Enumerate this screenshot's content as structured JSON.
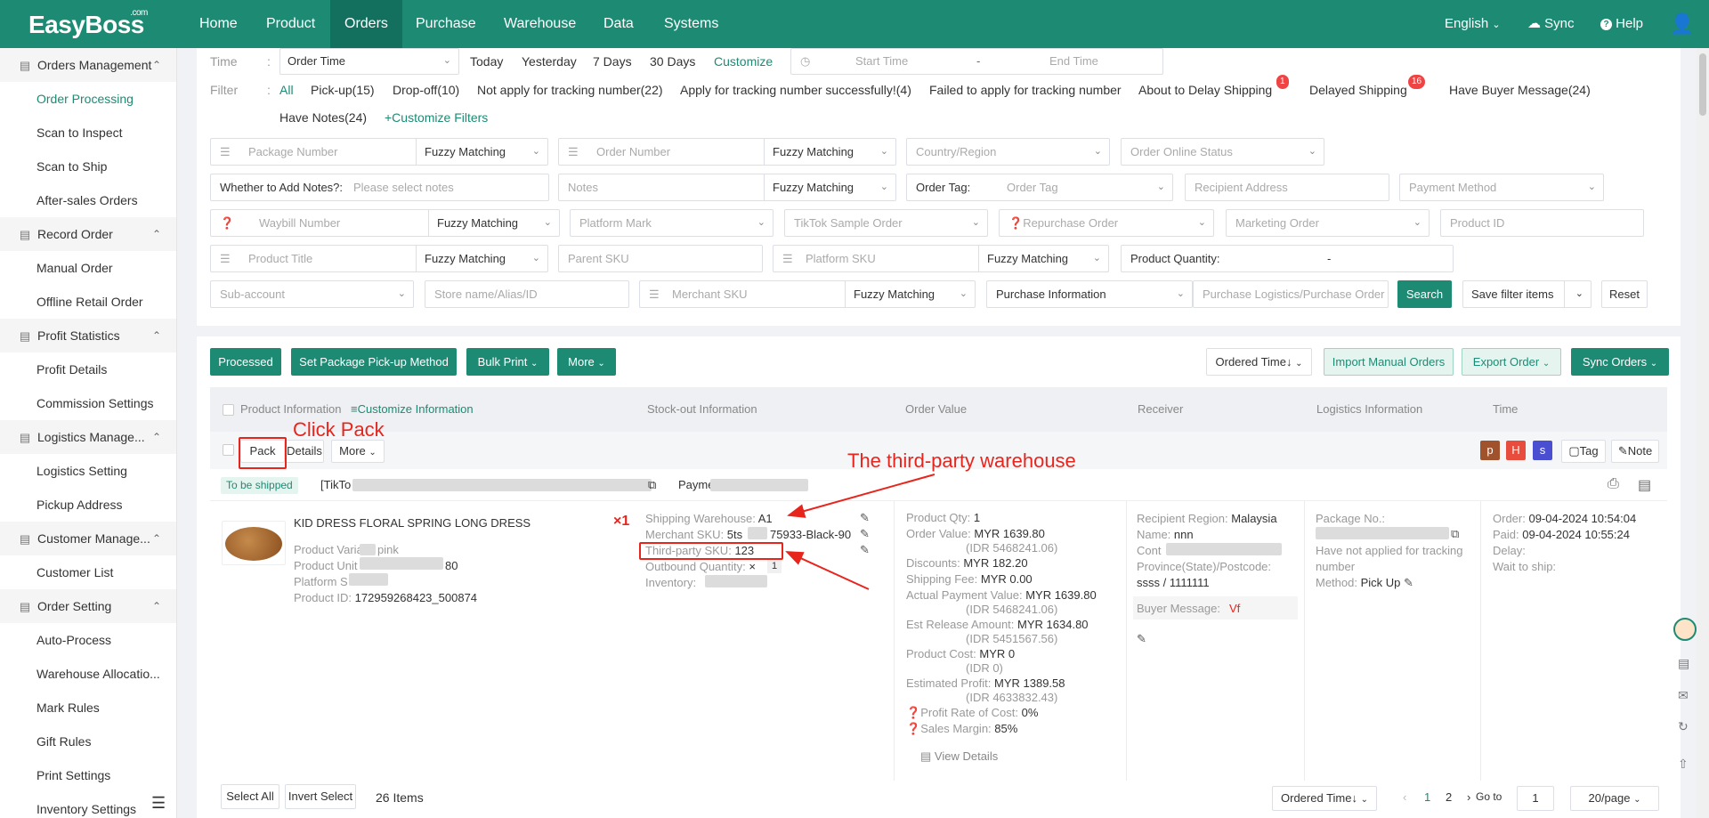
{
  "brand": {
    "logo": "EasyBoss",
    "logo_sup": ".com"
  },
  "topnav": {
    "items": [
      "Home",
      "Product",
      "Orders",
      "Purchase",
      "Warehouse",
      "Data",
      "Systems"
    ],
    "language": "English",
    "sync": "Sync",
    "help": "Help"
  },
  "sidebar": {
    "groups": [
      {
        "label": "Orders Management",
        "items": [
          "Order Processing",
          "Scan to Inspect",
          "Scan to Ship",
          "After-sales Orders"
        ]
      },
      {
        "label": "Record Order",
        "items": [
          "Manual Order",
          "Offline Retail Order"
        ]
      },
      {
        "label": "Profit Statistics",
        "items": [
          "Profit Details",
          "Commission Settings"
        ]
      },
      {
        "label": "Logistics Manage...",
        "items": [
          "Logistics Setting",
          "Pickup Address"
        ]
      },
      {
        "label": "Customer Manage...",
        "items": [
          "Customer List"
        ]
      },
      {
        "label": "Order Setting",
        "items": [
          "Auto-Process",
          "Warehouse Allocatio...",
          "Mark Rules",
          "Gift Rules",
          "Print Settings",
          "Inventory Settings"
        ]
      }
    ]
  },
  "filters": {
    "time_label": "Time",
    "time_select": "Order Time",
    "time_quick": [
      "Today",
      "Yesterday",
      "7 Days",
      "30 Days",
      "Customize"
    ],
    "start_time": "Start Time",
    "range_sep": "-",
    "end_time": "End Time",
    "filter_label": "Filter",
    "filter_items": [
      "All",
      "Pick-up(15)",
      "Drop-off(10)",
      "Not apply for tracking number(22)",
      "Apply for tracking number successfully!(4)",
      "Failed to apply for tracking number",
      "About to Delay Shipping",
      "Delayed Shipping",
      "Have Buyer Message(24)"
    ],
    "about_delay_badge": "1",
    "delayed_badge": "16",
    "have_notes": "Have Notes(24)",
    "customize_filters": "+Customize Filters",
    "row1": {
      "package_number": "Package Number",
      "fuzzy": "Fuzzy Matching",
      "order_number": "Order Number",
      "country": "Country/Region",
      "online_status": "Order Online Status"
    },
    "row2": {
      "notes_label": "Whether to Add Notes?:",
      "notes_ph": "Please select notes",
      "notes": "Notes",
      "fuzzy": "Fuzzy Matching",
      "order_tag_label": "Order Tag:",
      "order_tag_ph": "Order Tag",
      "recipient": "Recipient Address",
      "payment": "Payment Method"
    },
    "row3": {
      "waybill": "Waybill Number",
      "fuzzy": "Fuzzy Matching",
      "platform_mark": "Platform Mark",
      "tiktok_sample": "TikTok Sample Order",
      "repurchase": "Repurchase Order",
      "marketing": "Marketing Order",
      "product_id": "Product ID"
    },
    "row4": {
      "product_title": "Product Title",
      "fuzzy": "Fuzzy Matching",
      "parent_sku": "Parent SKU",
      "platform_sku": "Platform SKU",
      "fuzzy2": "Fuzzy Matching",
      "qty_label": "Product Quantity:",
      "qty_sep": "-"
    },
    "row5": {
      "sub_account": "Sub-account",
      "store": "Store name/Alias/ID",
      "merchant_sku": "Merchant SKU",
      "fuzzy": "Fuzzy Matching",
      "purchase_info": "Purchase Information",
      "purchase_logistics": "Purchase Logistics/Purchase Order",
      "search": "Search",
      "save_filter": "Save filter items",
      "reset": "Reset"
    }
  },
  "toolbar": {
    "processed": "Processed",
    "set_pickup": "Set Package Pick-up Method",
    "bulk_print": "Bulk Print",
    "more": "More",
    "ordered_time": "Ordered Time↓",
    "import_manual": "Import Manual Orders",
    "export": "Export Order",
    "sync_orders": "Sync Orders"
  },
  "table": {
    "headers": [
      "Product Information",
      "Customize Information",
      "Stock-out Information",
      "Order Value",
      "Receiver",
      "Logistics Information",
      "Time"
    ]
  },
  "row_actions": {
    "pack": "Pack",
    "details": "Details",
    "more": "More",
    "tag_p": "p",
    "tag_h": "H",
    "tag_s": "s",
    "tag": "Tag",
    "note": "Note"
  },
  "order": {
    "status": "To be shipped",
    "platform_prefix": "[TikTo",
    "payment_prefix": "Payme",
    "product_title": "KID DRESS FLORAL SPRING LONG DRESS",
    "qty_mark": "×1",
    "product_variation": "Product Variat",
    "product_variation_tail": "pink",
    "product_unit": "Product Unit P",
    "product_unit_tail": "80",
    "platform_s": "Platform S",
    "product_id_label": "Product ID:",
    "product_id": "172959268423_500874",
    "shipping_warehouse_label": "Shipping Warehouse:",
    "shipping_warehouse": "A1",
    "merchant_sku_label": "Merchant SKU:",
    "merchant_sku_a": "5ts",
    "merchant_sku_b": "75933-Black-90",
    "third_party_sku_label": "Third-party SKU:",
    "third_party_sku": "123",
    "outbound_label": "Outbound Quantity:",
    "outbound_x": "×",
    "outbound_qty": "1",
    "inventory_label": "Inventory:",
    "values": [
      {
        "label": "Product Qty:",
        "value": "1"
      },
      {
        "label": "Order Value:",
        "value": "MYR 1639.80",
        "sub": "(IDR 5468241.06)"
      },
      {
        "label": "Discounts:",
        "value": "MYR 182.20"
      },
      {
        "label": "Shipping Fee:",
        "value": "MYR 0.00"
      },
      {
        "label": "Actual Payment Value:",
        "value": "MYR 1639.80",
        "sub": "(IDR 5468241.06)"
      },
      {
        "label": "Est Release Amount:",
        "value": "MYR 1634.80",
        "sub": "(IDR 5451567.56)"
      },
      {
        "label": "Product Cost:",
        "value": "MYR 0",
        "sub": "(IDR 0)"
      },
      {
        "label": "Estimated Profit:",
        "value": "MYR 1389.58",
        "sub": "(IDR 4633832.43)"
      },
      {
        "label": "Profit Rate of Cost:",
        "value": "0%"
      },
      {
        "label": "Sales Margin:",
        "value": "85%"
      }
    ],
    "view_details": "View Details",
    "recipient_region_label": "Recipient Region:",
    "recipient_region": "Malaysia",
    "name_label": "Name:",
    "name": "nnn",
    "contact_label": "Cont",
    "province_label": "Province(State)/Postcode:",
    "province": "ssss / 1111111",
    "buyer_message_label": "Buyer Message:",
    "buyer_message": "Vf",
    "package_no_label": "Package No.:",
    "tracking_status": "Have not applied for tracking number",
    "method_label": "Method:",
    "method": "Pick Up",
    "order_time_label": "Order:",
    "order_time": "09-04-2024 10:54:04",
    "paid_label": "Paid:",
    "paid_time": "09-04-2024 10:55:24",
    "delay_label": "Delay:",
    "wait_label": "Wait to ship:"
  },
  "annotations": {
    "click_pack": "Click Pack",
    "third_party": "The third-party warehouse"
  },
  "footer": {
    "select_all": "Select All",
    "invert": "Invert Select",
    "count": "26 Items",
    "ordered_time": "Ordered Time↓",
    "pages": [
      "1",
      "2"
    ],
    "goto": "Go to",
    "goto_value": "1",
    "per_page": "20/page"
  },
  "colors": {
    "brand": "#1d8b74",
    "annotation": "#e8251d",
    "badge": "#f04444"
  }
}
